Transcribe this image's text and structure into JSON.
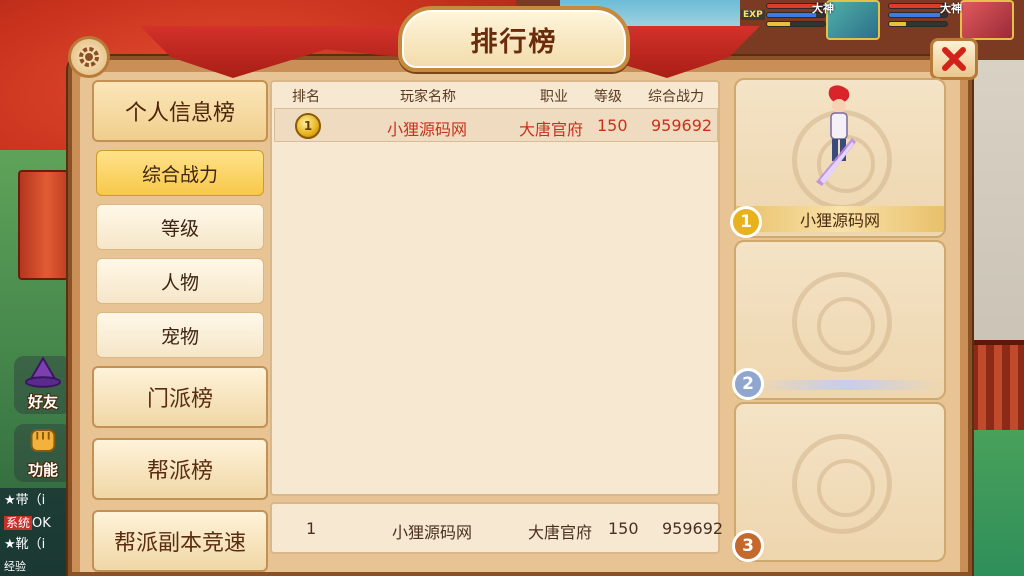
{
  "screen_title": "排行榜",
  "hud": {
    "exp_label": "EXP",
    "player_tag": "大神",
    "pet_tag": "大神"
  },
  "side_buttons": [
    {
      "label": "好友"
    },
    {
      "label": "功能"
    }
  ],
  "chat": {
    "line1": "★带（i",
    "sys_tag": "系统",
    "line2": "OK",
    "line3": "★靴（i",
    "line4": "经验"
  },
  "tabs": {
    "personal": "个人信息榜",
    "sub": [
      "综合战力",
      "等级",
      "人物",
      "宠物"
    ],
    "sect": "门派榜",
    "guild": "帮派榜",
    "guild_dungeon": "帮派副本竞速"
  },
  "table": {
    "headers": {
      "rank": "排名",
      "name": "玩家名称",
      "job": "职业",
      "level": "等级",
      "power": "综合战力"
    },
    "rows": [
      {
        "rank": "1",
        "name": "小狸源码网",
        "job": "大唐官府",
        "level": "150",
        "power": "959692"
      }
    ]
  },
  "my_rank": {
    "rank": "1",
    "name": "小狸源码网",
    "job": "大唐官府",
    "level": "150",
    "power": "959692"
  },
  "podium": [
    {
      "place": "1",
      "name": "小狸源码网"
    },
    {
      "place": "2",
      "name": ""
    },
    {
      "place": "3",
      "name": ""
    }
  ],
  "colors": {
    "active_tab": "#f7c84a",
    "highlight_text": "#c8321d",
    "gold": "#e7b21c",
    "silver": "#8fa6cf",
    "bronze": "#c4682c"
  }
}
